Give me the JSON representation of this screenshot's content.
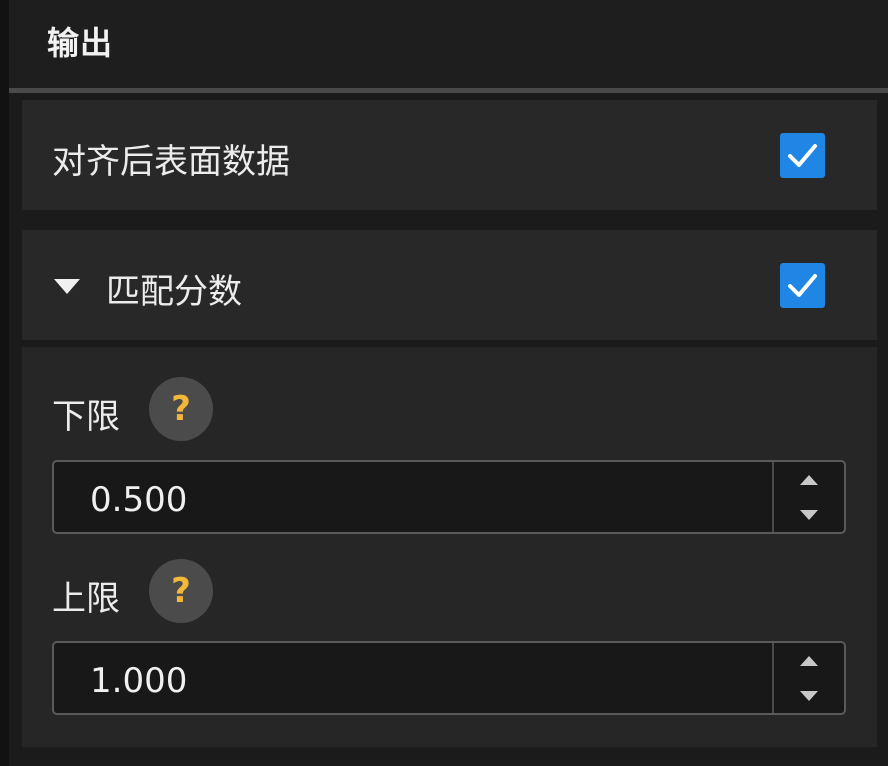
{
  "header": {
    "title": "输出"
  },
  "aligned_surface": {
    "label": "对齐后表面数据",
    "checked": true
  },
  "match_score": {
    "label": "匹配分数",
    "checked": true,
    "expanded": true,
    "lower": {
      "label": "下限",
      "help": "?",
      "value": "0.500"
    },
    "upper": {
      "label": "上限",
      "help": "?",
      "value": "1.000"
    }
  },
  "colors": {
    "accent": "#1f86e6",
    "help_mark": "#f3b73a"
  },
  "icons": [
    "check-icon",
    "caret-down-icon",
    "help-icon",
    "spin-up-icon",
    "spin-down-icon"
  ]
}
